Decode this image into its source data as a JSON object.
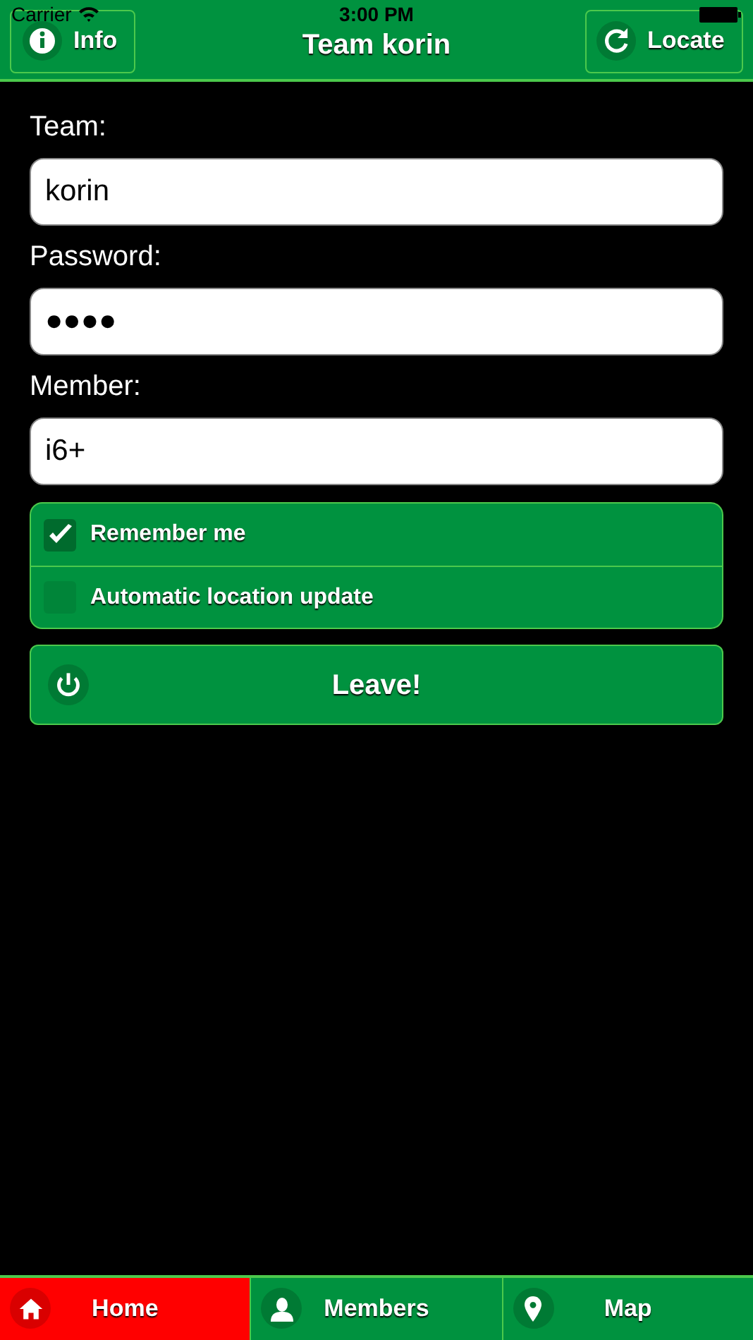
{
  "status_bar": {
    "carrier": "Carrier",
    "time": "3:00 PM"
  },
  "header": {
    "title": "Team korin",
    "left_button": "Info",
    "right_button": "Locate"
  },
  "form": {
    "fields": [
      {
        "label": "Team:",
        "value": "korin"
      },
      {
        "label": "Password:",
        "value": "●●●●"
      },
      {
        "label": "Member:",
        "value": "i6+"
      }
    ],
    "options": [
      {
        "label": "Remember me",
        "checked": true
      },
      {
        "label": "Automatic location update",
        "checked": false
      }
    ],
    "action_button": "Leave!"
  },
  "tabs": [
    {
      "label": "Home",
      "selected": true
    },
    {
      "label": "Members",
      "selected": false
    },
    {
      "label": "Map",
      "selected": false
    }
  ]
}
